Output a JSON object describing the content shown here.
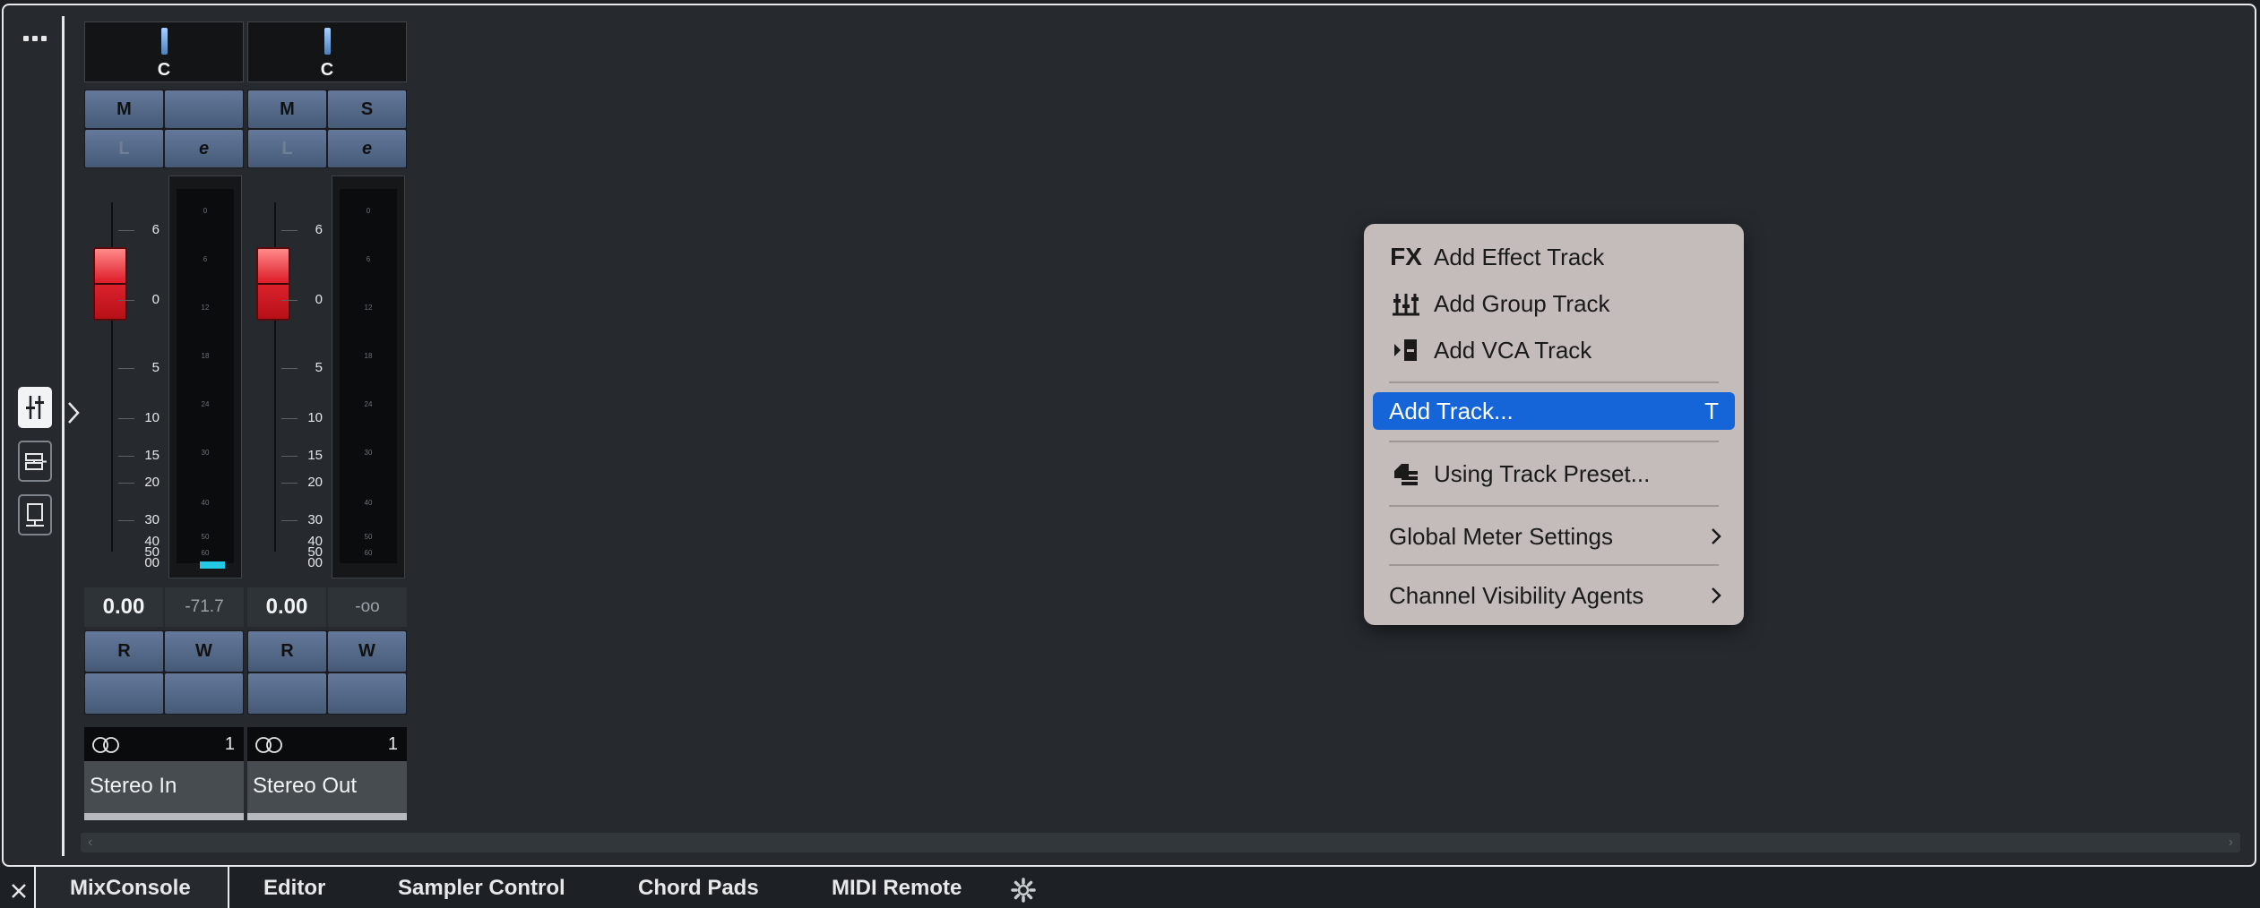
{
  "sidebar": {
    "more_icon": "ellipsis-icon",
    "buttons": [
      {
        "name": "mixer-icon",
        "active": true
      },
      {
        "name": "routing-icon",
        "active": false
      },
      {
        "name": "rack-icon",
        "active": false
      }
    ]
  },
  "channels": [
    {
      "pan_label": "C",
      "top_buttons": [
        "M",
        "",
        "L",
        "e"
      ],
      "scale_labels": [
        "6",
        "0",
        "5",
        "10",
        "15",
        "20",
        "30",
        "40",
        "50",
        "00"
      ],
      "meter_labels": [
        "0",
        "6",
        "12",
        "18",
        "24",
        "30",
        "40",
        "50",
        "60"
      ],
      "gain": "0.00",
      "peak": "-71.7",
      "rw_buttons": [
        "R",
        "W",
        "",
        ""
      ],
      "io_number": "1",
      "name": "Stereo In"
    },
    {
      "pan_label": "C",
      "top_buttons": [
        "M",
        "S",
        "L",
        "e"
      ],
      "scale_labels": [
        "6",
        "0",
        "5",
        "10",
        "15",
        "20",
        "30",
        "40",
        "50",
        "00"
      ],
      "meter_labels": [
        "0",
        "6",
        "12",
        "18",
        "24",
        "30",
        "40",
        "50",
        "60"
      ],
      "gain": "0.00",
      "peak": "-oo",
      "rw_buttons": [
        "R",
        "W",
        "",
        ""
      ],
      "io_number": "1",
      "name": "Stereo Out"
    }
  ],
  "context_menu": {
    "items": [
      {
        "label": "Add Effect Track",
        "icon": "fx-icon",
        "icon_text": "FX"
      },
      {
        "label": "Add Group Track",
        "icon": "group-track-icon"
      },
      {
        "label": "Add VCA Track",
        "icon": "vca-track-icon"
      },
      {
        "label": "Add Track...",
        "shortcut": "T",
        "highlighted": true
      },
      {
        "label": "Using Track Preset...",
        "icon": "track-preset-icon"
      },
      {
        "label": "Global Meter Settings",
        "submenu": true
      },
      {
        "label": "Channel Visibility Agents",
        "submenu": true
      }
    ],
    "highlight_color": "#1565d8"
  },
  "tabs": {
    "items": [
      "MixConsole",
      "Editor",
      "Sampler Control",
      "Chord Pads",
      "MIDI Remote"
    ],
    "active": "MixConsole"
  },
  "colors": {
    "fader": "#e0232e",
    "meter_peak": "#24c9e6",
    "button": "#465a78"
  }
}
